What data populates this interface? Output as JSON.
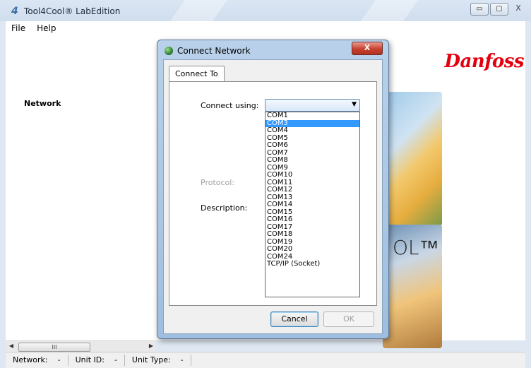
{
  "app": {
    "title": "Tool4Cool® LabEdition",
    "window_buttons": {
      "minimize": "▭",
      "maximize": "▢",
      "close": "X"
    }
  },
  "menu": {
    "items": [
      "File",
      "Help"
    ]
  },
  "main": {
    "network_label": "Network",
    "brand": "Danfoss",
    "splash_text": "OL™"
  },
  "scrollbar": {
    "thumb_grip": "III"
  },
  "status": {
    "network_label": "Network:",
    "network_value": "-",
    "unit_id_label": "Unit ID:",
    "unit_id_value": "-",
    "unit_type_label": "Unit Type:",
    "unit_type_value": "-"
  },
  "dialog": {
    "title": "Connect Network",
    "close_label": "X",
    "tab": "Connect To",
    "connect_using_label": "Connect using:",
    "connect_using_value": "",
    "protocol_label": "Protocol:",
    "description_label": "Description:",
    "options": [
      "COM1",
      "COM3",
      "COM4",
      "COM5",
      "COM6",
      "COM7",
      "COM8",
      "COM9",
      "COM10",
      "COM11",
      "COM12",
      "COM13",
      "COM14",
      "COM15",
      "COM16",
      "COM17",
      "COM18",
      "COM19",
      "COM20",
      "COM24",
      "TCP/IP (Socket)"
    ],
    "highlighted_option": "COM3",
    "cancel_label": "Cancel",
    "ok_label": "OK"
  },
  "colors": {
    "brand_red": "#e2000f",
    "selection_blue": "#3399ff"
  }
}
